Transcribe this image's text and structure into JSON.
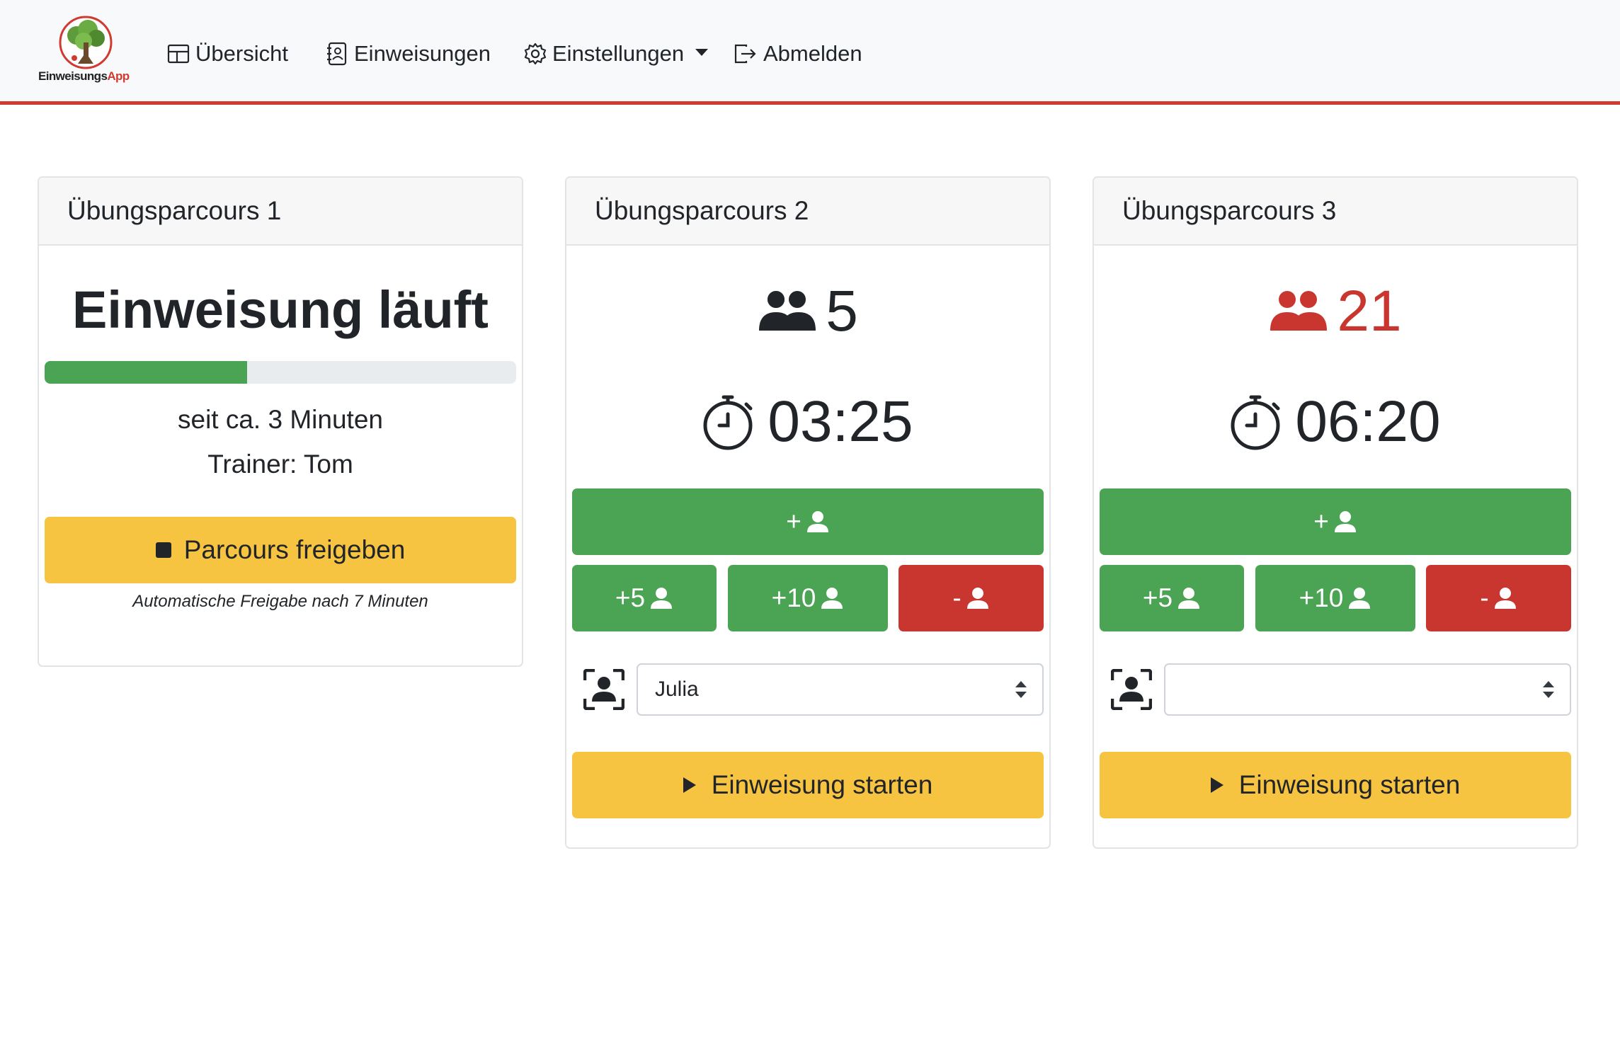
{
  "navbar": {
    "brand": {
      "part1": "Einweisungs",
      "part2": "App"
    },
    "items": [
      {
        "label": "Übersicht",
        "icon": "layout-icon"
      },
      {
        "label": "Einweisungen",
        "icon": "contacts-book-icon"
      },
      {
        "label": "Einstellungen",
        "icon": "gear-icon"
      },
      {
        "label": "Abmelden",
        "icon": "logout-icon"
      }
    ]
  },
  "colors": {
    "accent": "#d03a31",
    "success": "#4ba354",
    "danger": "#c9352f",
    "warning": "#f7c442"
  },
  "cards": [
    {
      "title": "Übungsparcours 1",
      "status": "Einweisung läuft",
      "progress": 0.43,
      "since": "seit ca. 3 Minuten",
      "trainer": "Trainer: Tom",
      "button": "Parcours freigeben",
      "note": "Automatische Freigabe nach 7 Minuten"
    },
    {
      "title": "Übungsparcours 2",
      "count": "5",
      "timer": "03:25",
      "buttons": {
        "add_one": "+",
        "add_five": "+5",
        "add_ten": "+10",
        "remove": "-"
      },
      "trainer_select": "Julia",
      "start_button": "Einweisung starten"
    },
    {
      "title": "Übungsparcours 3",
      "count": "21",
      "timer": "06:20",
      "buttons": {
        "add_one": "+",
        "add_five": "+5",
        "add_ten": "+10",
        "remove": "-"
      },
      "trainer_select": "",
      "start_button": "Einweisung starten"
    }
  ]
}
